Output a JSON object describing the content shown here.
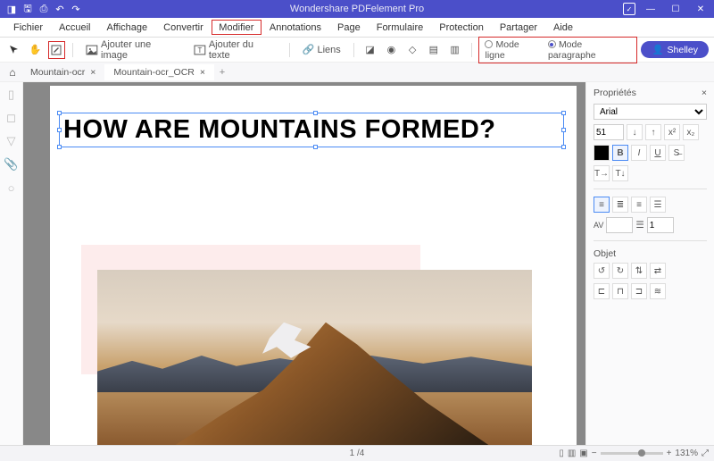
{
  "titlebar": {
    "title": "Wondershare PDFelement Pro"
  },
  "menu": [
    "Fichier",
    "Accueil",
    "Affichage",
    "Convertir",
    "Modifier",
    "Annotations",
    "Page",
    "Formulaire",
    "Protection",
    "Partager",
    "Aide"
  ],
  "menu_highlight_index": 4,
  "toolbar": {
    "add_image": "Ajouter une image",
    "add_text": "Ajouter du texte",
    "links": "Liens",
    "mode_line": "Mode ligne",
    "mode_para": "Mode paragraphe",
    "mode_selected": "para",
    "user": "Shelley"
  },
  "tabs": [
    {
      "label": "Mountain-ocr",
      "active": false
    },
    {
      "label": "Mountain-ocr_OCR",
      "active": true
    }
  ],
  "document": {
    "selected_text": "HOW ARE MOUNTAINS FORMED?"
  },
  "properties": {
    "title": "Propriétés",
    "font": "Arial",
    "size": "51",
    "object_label": "Objet",
    "spacing_av": "AV",
    "line_height": "1",
    "color": "#000000"
  },
  "status": {
    "page": "1 /4",
    "zoom": "131%"
  }
}
